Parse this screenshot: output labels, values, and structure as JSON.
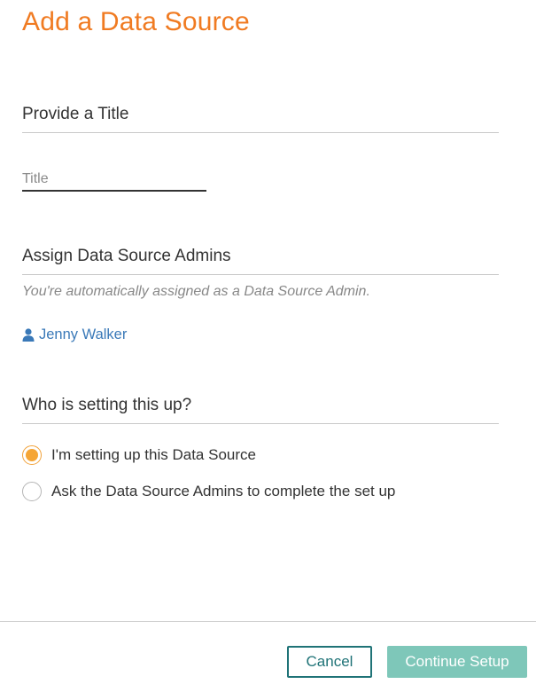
{
  "dialog": {
    "title": "Add a Data Source"
  },
  "title_section": {
    "heading": "Provide a Title",
    "input_placeholder": "Title",
    "input_value": ""
  },
  "admins_section": {
    "heading": "Assign Data Source Admins",
    "hint": "You're automatically assigned as a Data Source Admin.",
    "admin_name": "Jenny Walker",
    "admin_icon": "user-icon"
  },
  "setup_section": {
    "heading": "Who is setting this up?",
    "options": [
      {
        "label": "I'm setting up this Data Source",
        "selected": true
      },
      {
        "label": "Ask the Data Source Admins to complete the set up",
        "selected": false
      }
    ]
  },
  "footer": {
    "cancel_label": "Cancel",
    "continue_label": "Continue Setup"
  },
  "colors": {
    "title_accent": "#f07b22",
    "link": "#3a79b8",
    "radio_selected": "#f5a535",
    "cancel_border": "#1f7377",
    "continue_bg": "#7ec7b9"
  }
}
